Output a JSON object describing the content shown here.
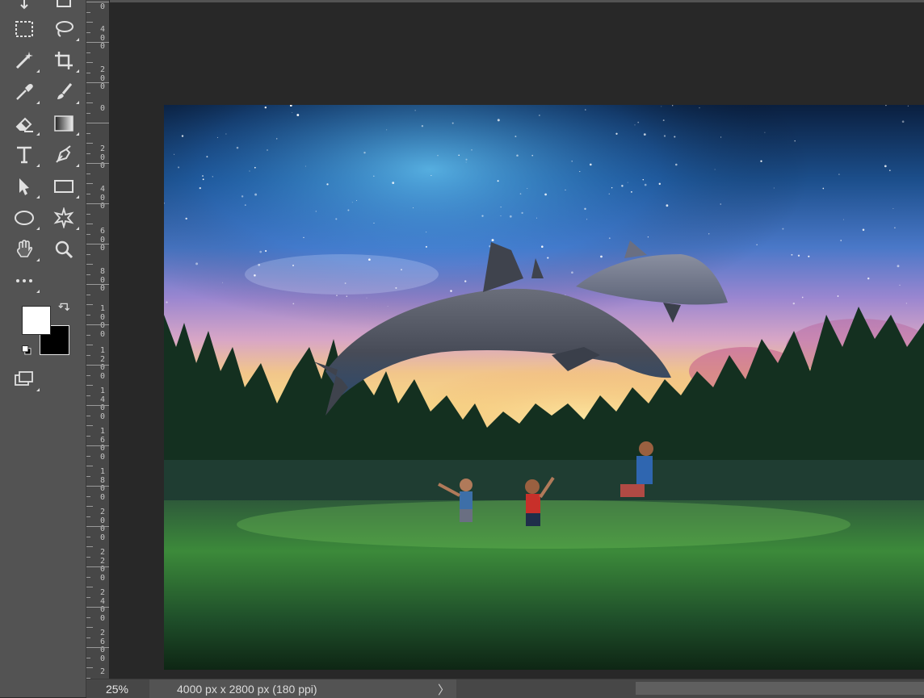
{
  "statusbar": {
    "zoom": "25%",
    "doc_info": "4000 px x 2800 px (180 ppi)",
    "arrow": "〉"
  },
  "ruler": {
    "labels": [
      "0",
      "4\n0\n0",
      "2\n0\n0",
      "0",
      "2\n0\n0",
      "4\n0\n0",
      "6\n0\n0",
      "8\n0\n0",
      "1\n0\n0\n0",
      "1\n2\n0\n0",
      "1\n4\n0\n0",
      "1\n6\n0\n0",
      "1\n8\n0\n0",
      "2\n0\n0\n0",
      "2\n2\n0\n0",
      "2\n4\n0\n0",
      "2\n6\n0\n0",
      "2"
    ]
  },
  "toolbar": {
    "tools": [
      {
        "name": "move-tool-icon"
      },
      {
        "name": "artboard-tool-icon"
      },
      {
        "name": "rectangular-marquee-icon"
      },
      {
        "name": "lasso-icon"
      },
      {
        "name": "magic-wand-icon"
      },
      {
        "name": "crop-icon"
      },
      {
        "name": "eyedropper-icon"
      },
      {
        "name": "brush-icon"
      },
      {
        "name": "eraser-icon"
      },
      {
        "name": "gradient-icon"
      },
      {
        "name": "type-icon"
      },
      {
        "name": "pen-icon"
      },
      {
        "name": "path-selection-icon"
      },
      {
        "name": "rectangle-tool-icon"
      },
      {
        "name": "ellipse-tool-icon"
      },
      {
        "name": "custom-shape-icon"
      },
      {
        "name": "hand-icon"
      },
      {
        "name": "zoom-icon"
      },
      {
        "name": "more-tools-icon"
      }
    ],
    "foreground_color": "#ffffff",
    "background_color": "#000000"
  },
  "colors": {
    "toolbar_bg": "#535353",
    "workspace_bg": "#282828"
  }
}
